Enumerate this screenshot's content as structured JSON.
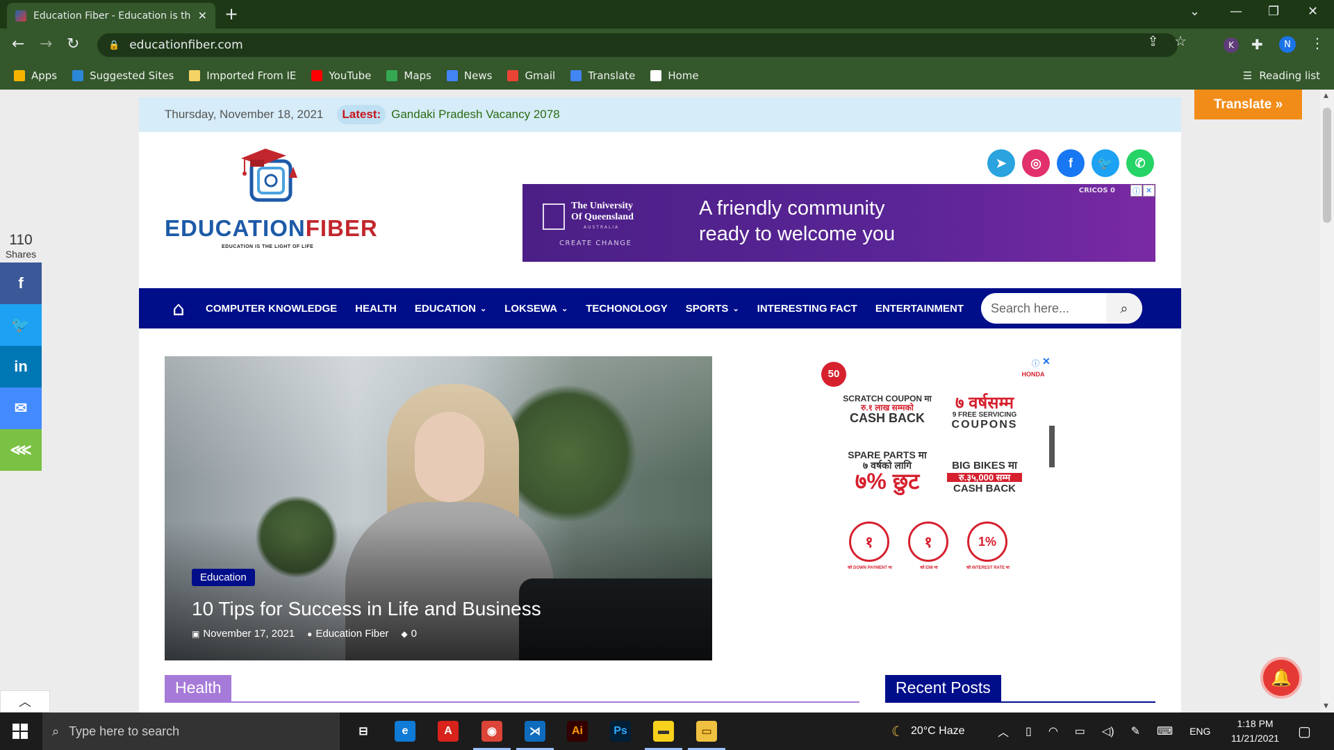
{
  "browser": {
    "tab_title": "Education Fiber - Education is th",
    "tab_close": "✕",
    "new_tab": "+",
    "url": "educationfiber.com",
    "extension_k": "K",
    "profile_initial": "N",
    "bookmarks": [
      {
        "label": "Apps",
        "icon": "apps-grid-icon",
        "color": "#f4b400"
      },
      {
        "label": "Suggested Sites",
        "icon": "bing-icon",
        "color": "#2b88d8"
      },
      {
        "label": "Imported From IE",
        "icon": "folder-icon",
        "color": "#f6d365"
      },
      {
        "label": "YouTube",
        "icon": "youtube-icon",
        "color": "#ff0000"
      },
      {
        "label": "Maps",
        "icon": "maps-pin-icon",
        "color": "#34a853"
      },
      {
        "label": "News",
        "icon": "news-icon",
        "color": "#4285f4"
      },
      {
        "label": "Gmail",
        "icon": "gmail-icon",
        "color": "#ea4335"
      },
      {
        "label": "Translate",
        "icon": "translate-icon",
        "color": "#4285f4"
      },
      {
        "label": "Home",
        "icon": "globe-icon",
        "color": "#ffffff"
      }
    ],
    "reading_list": "Reading list"
  },
  "site": {
    "date": "Thursday, November 18, 2021",
    "latest_label": "Latest:",
    "latest_text": "Gandaki Pradesh Vacancy 2078",
    "logo_education": "EDUCATION",
    "logo_fiber": "FIBER",
    "logo_tagline": "EDUCATION IS THE LIGHT OF LIFE",
    "socials": [
      {
        "name": "telegram",
        "color": "#2aa3df",
        "glyph": "➤"
      },
      {
        "name": "instagram",
        "color": "#e1306c",
        "glyph": "◎"
      },
      {
        "name": "facebook",
        "color": "#1877f2",
        "glyph": "f"
      },
      {
        "name": "twitter",
        "color": "#1da1f2",
        "glyph": "🐦"
      },
      {
        "name": "whatsapp",
        "color": "#25d366",
        "glyph": "✆"
      }
    ],
    "translate_button": "Translate »"
  },
  "uq_ad": {
    "university_line1": "The University",
    "university_line2": "Of Queensland",
    "country": "AUSTRALIA",
    "slogan": "CREATE CHANGE",
    "headline_line1": "A friendly community",
    "headline_line2": "ready to welcome you",
    "cricos": "CRICOS 0"
  },
  "nav": {
    "items": [
      {
        "label": "COMPUTER KNOWLEDGE",
        "dropdown": false
      },
      {
        "label": "HEALTH",
        "dropdown": false
      },
      {
        "label": "EDUCATION",
        "dropdown": true
      },
      {
        "label": "LOKSEWA",
        "dropdown": true
      },
      {
        "label": "TECHONOLOGY",
        "dropdown": false
      },
      {
        "label": "SPORTS",
        "dropdown": true
      },
      {
        "label": "INTERESTING FACT",
        "dropdown": false
      },
      {
        "label": "ENTERTAINMENT",
        "dropdown": false
      }
    ],
    "search_placeholder": "Search here..."
  },
  "hero": {
    "category": "Education",
    "title": "10 Tips for Success in Life and Business",
    "date": "November 17, 2021",
    "author": "Education Fiber",
    "comments": "0"
  },
  "honda_ad": {
    "years": "50",
    "brand": "HONDA",
    "offer1_line1": "SCRATCH COUPON मा",
    "offer1_line2": "रु.१ लाख सम्मको",
    "offer1_line3": "CASH BACK",
    "offer2_line1": "७ वर्षसम्म",
    "offer2_line2": "9 FREE SERVICING",
    "offer2_line3": "COUPONS",
    "offer3_line1": "SPARE PARTS मा",
    "offer3_line2": "७ वर्षको लागि",
    "offer3_line3": "७% छुट",
    "offer4_line1": "BIG BIKES मा",
    "offer4_line2": "रु.३५,000 सम्म",
    "offer4_line3": "CASH BACK",
    "circle1": "१",
    "circle2": "१",
    "circle3": "1%",
    "circle1_caption": "को DOWN PAYMENT मा",
    "circle2_caption": "को EMI मा",
    "circle3_caption": "को INTEREST RATE मा"
  },
  "sections": {
    "health": "Health",
    "recent_posts": "Recent Posts"
  },
  "share": {
    "count": "110",
    "label": "Shares",
    "buttons": [
      {
        "name": "facebook",
        "glyph": "f",
        "color": "#3b5998"
      },
      {
        "name": "twitter",
        "glyph": "🐦",
        "color": "#1da1f2"
      },
      {
        "name": "linkedin",
        "glyph": "in",
        "color": "#0077b5"
      },
      {
        "name": "messenger",
        "glyph": "✉",
        "color": "#448aff"
      },
      {
        "name": "share",
        "glyph": "⋘",
        "color": "#7bc143"
      }
    ]
  },
  "taskbar": {
    "search_placeholder": "Type here to search",
    "weather": "20°C  Haze",
    "language": "ENG",
    "time": "1:18 PM",
    "date": "11/21/2021",
    "apps": [
      {
        "name": "task-view",
        "label": "⊟",
        "bg": "transparent",
        "color": "#fff"
      },
      {
        "name": "edge",
        "label": "e",
        "bg": "#0f7bd6",
        "color": "#fff"
      },
      {
        "name": "acrobat",
        "label": "A",
        "bg": "#d8231c",
        "color": "#fff"
      },
      {
        "name": "chrome",
        "label": "◉",
        "bg": "#db4437",
        "color": "#fff"
      },
      {
        "name": "vscode",
        "label": "⋊",
        "bg": "#0f6cbd",
        "color": "#fff"
      },
      {
        "name": "illustrator",
        "label": "Ai",
        "bg": "#330000",
        "color": "#ff9a00"
      },
      {
        "name": "photoshop",
        "label": "Ps",
        "bg": "#001e36",
        "color": "#31a8ff"
      },
      {
        "name": "sticky-notes",
        "label": "▬",
        "bg": "#f7d11c",
        "color": "#333"
      },
      {
        "name": "file-explorer",
        "label": "▭",
        "bg": "#f0c040",
        "color": "#8a5a00"
      }
    ]
  }
}
